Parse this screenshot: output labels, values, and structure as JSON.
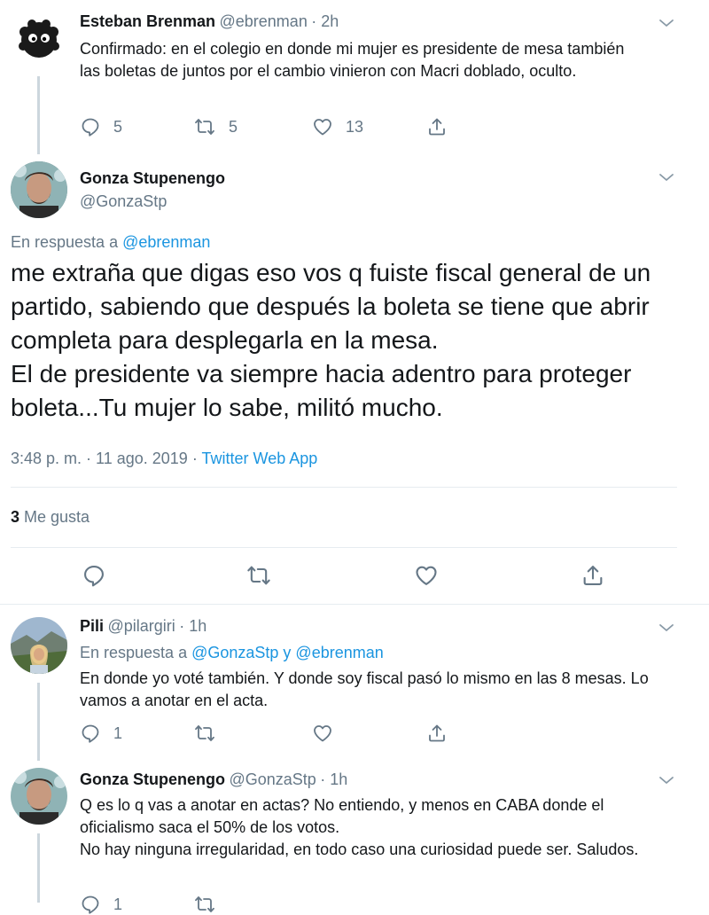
{
  "tweet1": {
    "name": "Esteban Brenman",
    "handle": "@ebrenman",
    "time": "· 2h",
    "text": "Confirmado: en el colegio en donde mi mujer es presidente de mesa también las boletas de juntos por el cambio vinieron con Macri doblado, oculto.",
    "replies": "5",
    "retweets": "5",
    "likes": "13"
  },
  "main_tweet": {
    "name": "Gonza Stupenengo",
    "handle": "@GonzaStp",
    "reply_prefix": "En respuesta a",
    "reply_to": "@ebrenman",
    "text": "me extraña que digas eso vos q fuiste fiscal general de un partido, sabiendo que después la boleta se tiene que abrir completa para desplegarla en la mesa.\nEl de presidente va siempre hacia adentro para proteger boleta...Tu mujer lo sabe, militó mucho.",
    "timestamp": "3:48 p. m. · 11 ago. 2019",
    "source": "Twitter Web App",
    "likes_count": "3",
    "likes_label": "Me gusta"
  },
  "reply1": {
    "name": "Pili",
    "handle": "@pilargiri",
    "time": "· 1h",
    "reply_prefix": "En respuesta a",
    "reply_to": "@GonzaStp y @ebrenman",
    "text": "En donde yo voté también. Y donde soy fiscal pasó lo mismo en las 8 mesas. Lo vamos a anotar en el acta.",
    "replies": "1"
  },
  "reply2": {
    "name": "Gonza Stupenengo",
    "handle": "@GonzaStp",
    "time": "· 1h",
    "text": "Q es lo q vas a anotar en actas? No entiendo, y menos en CABA donde el oficialismo saca el 50% de los votos.\nNo hay ninguna irregularidad, en todo caso una curiosidad puede ser. Saludos.",
    "replies": "1"
  },
  "colors": {
    "link": "#1b95e0",
    "muted": "#657786",
    "divider": "#e6ecf0"
  },
  "icons": [
    "reply-icon",
    "retweet-icon",
    "like-icon",
    "share-icon",
    "chevron-down-icon"
  ]
}
